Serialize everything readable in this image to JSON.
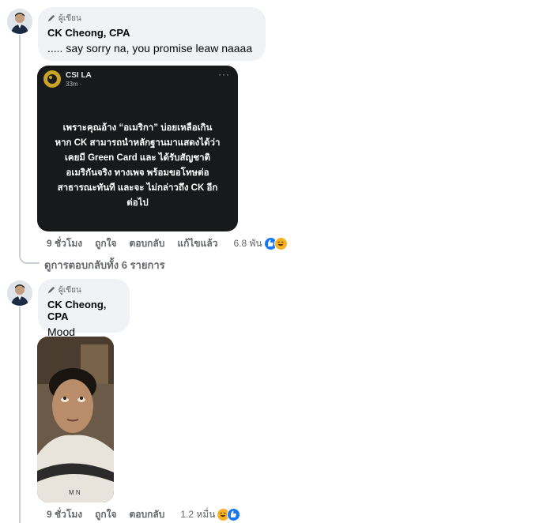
{
  "comments": [
    {
      "badge": "ผู้เขียน",
      "author": "CK Cheong, CPA",
      "text": "..... say sorry na, you promise leaw naaaa",
      "attachment": {
        "page_name": "CSI LA",
        "time": "33m ·",
        "body": "เพราะคุณอ้าง “อเมริกา” บ่อยเหลือเกิน หาก CK สามารถนำหลักฐานมาแสดงได้ว่า เคยมี Green Card และ ได้รับสัญชาติอเมริกันจริง ทางเพจ พร้อมขอโทษต่อ สาธารณะทันที และจะ ไม่กล่าวถึง CK อีกต่อไป"
      },
      "actions": {
        "time": "9 ชั่วโมง",
        "like": "ถูกใจ",
        "reply": "ตอบกลับ",
        "edited": "แก้ไขแล้ว",
        "reaction_count": "6.8 พัน"
      }
    },
    {
      "badge": "ผู้เขียน",
      "author": "CK Cheong, CPA",
      "text": "Mood",
      "actions": {
        "time": "9 ชั่วโมง",
        "like": "ถูกใจ",
        "reply": "ตอบกลับ",
        "reaction_count": "1.2 หมื่น"
      }
    }
  ],
  "view_replies": "ดูการตอบกลับทั้ง 6 รายการ",
  "colors": {
    "bubble": "#f0f2f5",
    "meta": "#65676b",
    "like": "#1877f2",
    "haha": "#f7b125"
  }
}
